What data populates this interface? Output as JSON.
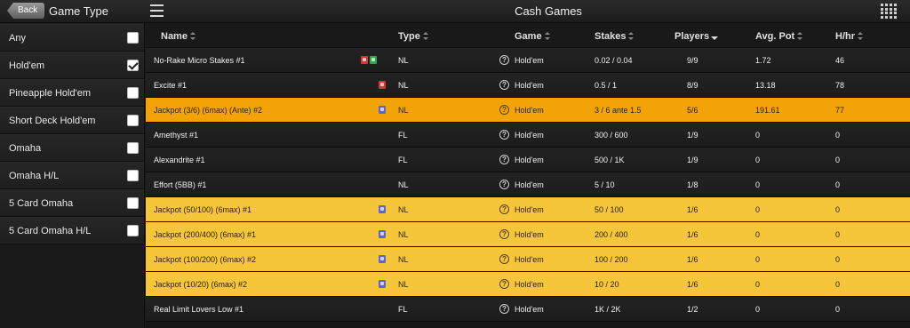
{
  "header": {
    "back_label": "Back",
    "sidebar_title": "Game Type",
    "title": "Cash Games"
  },
  "filters": [
    {
      "label": "Any",
      "checked": false
    },
    {
      "label": "Hold'em",
      "checked": true
    },
    {
      "label": "Pineapple Hold'em",
      "checked": false
    },
    {
      "label": "Short Deck Hold'em",
      "checked": false
    },
    {
      "label": "Omaha",
      "checked": false
    },
    {
      "label": "Omaha H/L",
      "checked": false
    },
    {
      "label": "5 Card Omaha",
      "checked": false
    },
    {
      "label": "5 Card Omaha H/L",
      "checked": false
    }
  ],
  "columns": {
    "name": "Name",
    "type": "Type",
    "game": "Game",
    "stakes": "Stakes",
    "players": "Players",
    "avgpot": "Avg. Pot",
    "hhr": "H/hr"
  },
  "colors": {
    "selected_row": "#f2a407",
    "jackpot_row": "#f5c63a",
    "badge_red": "#d33333",
    "badge_green": "#2fa84a",
    "badge_blue": "#5a66d8"
  },
  "rows": [
    {
      "name": "No-Rake Micro Stakes #1",
      "badges": [
        "red",
        "green"
      ],
      "type": "NL",
      "game": "Hold'em",
      "stakes": "0.02 / 0.04",
      "players": "9/9",
      "avgpot": "1.72",
      "hhr": "46",
      "style": "normal"
    },
    {
      "name": "Excite #1",
      "badges": [
        "red"
      ],
      "type": "NL",
      "game": "Hold'em",
      "stakes": "0.5 / 1",
      "players": "8/9",
      "avgpot": "13.18",
      "hhr": "78",
      "style": "normal"
    },
    {
      "name": "Jackpot (3/6) (6max) (Ante) #2",
      "badges": [
        "blue"
      ],
      "type": "NL",
      "game": "Hold'em",
      "stakes": "3 / 6 ante 1.5",
      "players": "5/6",
      "avgpot": "191.61",
      "hhr": "77",
      "style": "selected"
    },
    {
      "name": "Amethyst #1",
      "badges": [],
      "type": "FL",
      "game": "Hold'em",
      "stakes": "300 / 600",
      "players": "1/9",
      "avgpot": "0",
      "hhr": "0",
      "style": "normal"
    },
    {
      "name": "Alexandrite #1",
      "badges": [],
      "type": "FL",
      "game": "Hold'em",
      "stakes": "500 / 1K",
      "players": "1/9",
      "avgpot": "0",
      "hhr": "0",
      "style": "normal"
    },
    {
      "name": "Effort (5BB) #1",
      "badges": [],
      "type": "NL",
      "game": "Hold'em",
      "stakes": "5 / 10",
      "players": "1/8",
      "avgpot": "0",
      "hhr": "0",
      "style": "normal"
    },
    {
      "name": "Jackpot (50/100) (6max) #1",
      "badges": [
        "blue"
      ],
      "type": "NL",
      "game": "Hold'em",
      "stakes": "50 / 100",
      "players": "1/6",
      "avgpot": "0",
      "hhr": "0",
      "style": "jackpot"
    },
    {
      "name": "Jackpot (200/400) (6max) #1",
      "badges": [
        "blue"
      ],
      "type": "NL",
      "game": "Hold'em",
      "stakes": "200 / 400",
      "players": "1/6",
      "avgpot": "0",
      "hhr": "0",
      "style": "jackpot"
    },
    {
      "name": "Jackpot (100/200) (6max) #2",
      "badges": [
        "blue"
      ],
      "type": "NL",
      "game": "Hold'em",
      "stakes": "100 / 200",
      "players": "1/6",
      "avgpot": "0",
      "hhr": "0",
      "style": "jackpot"
    },
    {
      "name": "Jackpot (10/20) (6max) #2",
      "badges": [
        "blue"
      ],
      "type": "NL",
      "game": "Hold'em",
      "stakes": "10 / 20",
      "players": "1/6",
      "avgpot": "0",
      "hhr": "0",
      "style": "jackpot"
    },
    {
      "name": "Real Limit Lovers Low #1",
      "badges": [],
      "type": "FL",
      "game": "Hold'em",
      "stakes": "1K / 2K",
      "players": "1/2",
      "avgpot": "0",
      "hhr": "0",
      "style": "normal"
    }
  ]
}
